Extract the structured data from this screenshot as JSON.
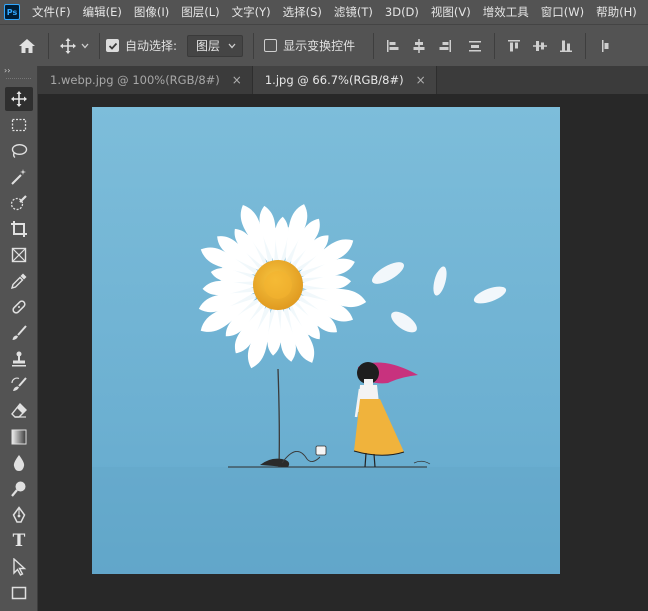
{
  "menubar": {
    "logo": "Ps",
    "items": [
      "文件(F)",
      "编辑(E)",
      "图像(I)",
      "图层(L)",
      "文字(Y)",
      "选择(S)",
      "滤镜(T)",
      "3D(D)",
      "视图(V)",
      "增效工具",
      "窗口(W)",
      "帮助(H)"
    ]
  },
  "options": {
    "auto_select_label": "自动选择:",
    "auto_select_checked": true,
    "target_value": "图层",
    "transform_controls_label": "显示变换控件",
    "transform_controls_checked": false
  },
  "tabs": [
    {
      "label": "1.webp.jpg @ 100%(RGB/8#)",
      "close": "×",
      "active": false
    },
    {
      "label": "1.jpg @ 66.7%(RGB/8#)",
      "close": "×",
      "active": true
    }
  ],
  "toolbar": {
    "collapse": "››",
    "tools": [
      "move",
      "marquee",
      "lasso",
      "magic-wand",
      "quick-selection",
      "crop",
      "frame",
      "eyedropper",
      "healing",
      "brush",
      "stamp",
      "history-brush",
      "eraser",
      "gradient",
      "blur",
      "dodge",
      "pen",
      "type",
      "path-selection",
      "rectangle"
    ],
    "active_tool": "move",
    "type_tool_glyph": "T"
  },
  "colors": {
    "panel": "#535353",
    "canvas_bg": "#282828",
    "image_sky": "#6ab0d2",
    "flower_center": "#f2b531",
    "dress": "#f0b33c",
    "hair_scarf": "#c8327e"
  }
}
